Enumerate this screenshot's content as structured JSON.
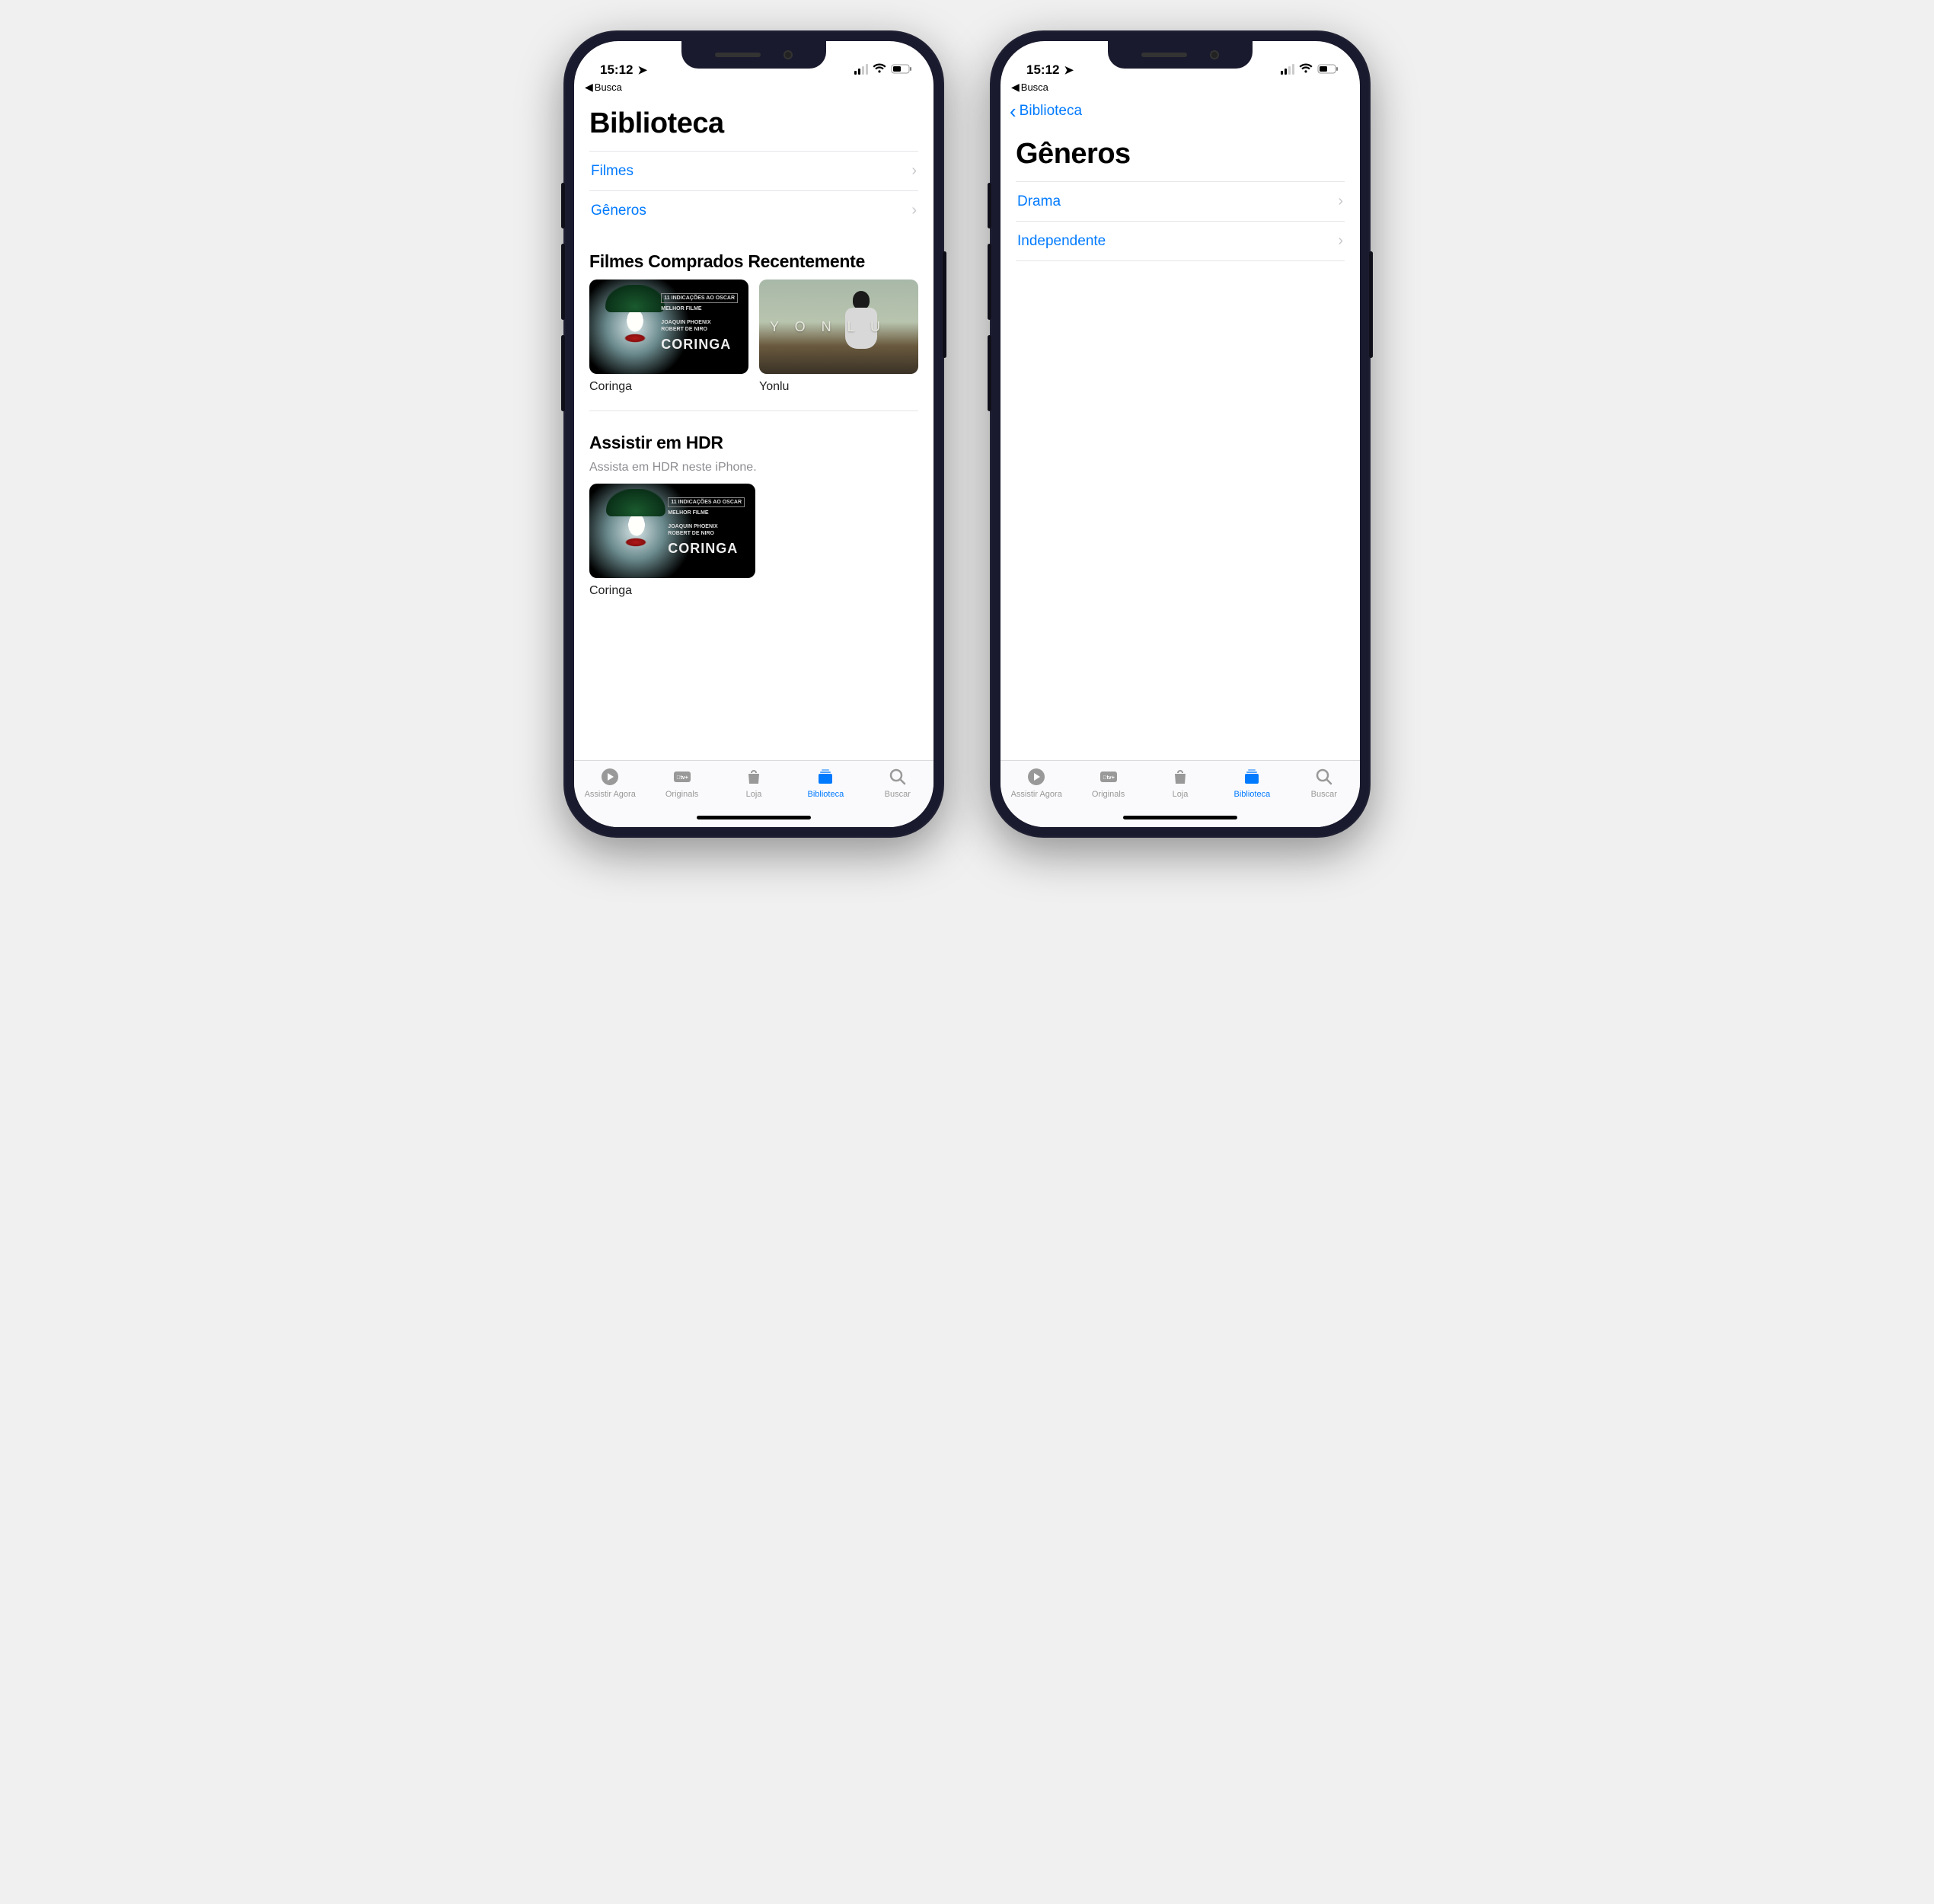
{
  "status": {
    "time": "15:12",
    "breadcrumb": "Busca"
  },
  "left": {
    "title": "Biblioteca",
    "rows": [
      "Filmes",
      "Gêneros"
    ],
    "section_recent": {
      "heading": "Filmes Comprados Recentemente",
      "movies": [
        "Coringa",
        "Yonlu"
      ],
      "poster_coringa": {
        "badge": "11 INDICAÇÕES AO OSCAR",
        "tagline": "MELHOR FILME",
        "credits": "JOAQUIN PHOENIX\nROBERT DE NIRO",
        "logo": "CORINGA"
      },
      "poster_yonlu": {
        "logo": "Y O N L U"
      }
    },
    "section_hdr": {
      "heading": "Assistir em HDR",
      "sub": "Assista em HDR neste iPhone.",
      "movies": [
        "Coringa"
      ]
    }
  },
  "right": {
    "back": "Biblioteca",
    "title": "Gêneros",
    "rows": [
      "Drama",
      "Independente"
    ]
  },
  "tabs": {
    "items": [
      "Assistir Agora",
      "Originals",
      "Loja",
      "Biblioteca",
      "Buscar"
    ],
    "active_index": 3
  }
}
